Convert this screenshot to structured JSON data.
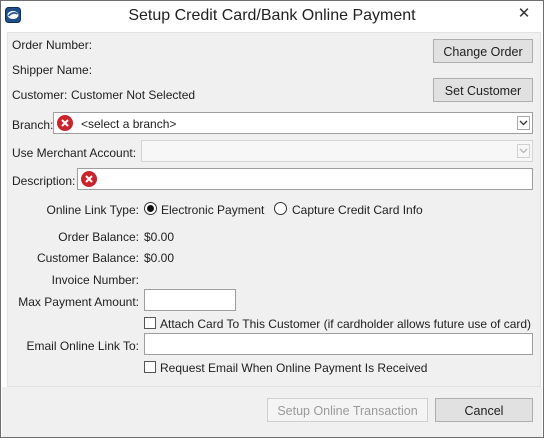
{
  "window": {
    "title": "Setup Credit Card/Bank Online Payment",
    "close_glyph": "✕"
  },
  "order": {
    "order_number_label": "Order Number:",
    "shipper_name_label": "Shipper Name:",
    "customer_label": "Customer:",
    "customer_value": "Customer Not Selected",
    "change_order_button": "Change Order",
    "set_customer_button": "Set Customer"
  },
  "branch": {
    "label": "Branch:",
    "value": "<select a branch>"
  },
  "merchant": {
    "label": "Use Merchant Account:",
    "value": ""
  },
  "description": {
    "label": "Description:",
    "value": ""
  },
  "online_link": {
    "label": "Online Link Type:",
    "options": [
      "Electronic Payment",
      "Capture Credit Card Info"
    ],
    "selected": "Electronic Payment"
  },
  "balances": {
    "order_balance_label": "Order Balance:",
    "order_balance_value": "$0.00",
    "customer_balance_label": "Customer Balance:",
    "customer_balance_value": "$0.00",
    "invoice_number_label": "Invoice Number:"
  },
  "payment": {
    "max_amount_label": "Max Payment Amount:",
    "max_amount_value": "",
    "attach_card_label": "Attach Card To This Customer (if cardholder allows future use of card)",
    "attach_card_checked": false
  },
  "email": {
    "label": "Email Online Link To:",
    "value": "",
    "request_email_label": "Request Email When Online Payment Is Received",
    "request_email_checked": false
  },
  "footer": {
    "setup_button": "Setup Online Transaction",
    "cancel_button": "Cancel"
  },
  "colors": {
    "error_icon": "#c8252c",
    "dialog_background": "#f0f0f0"
  }
}
